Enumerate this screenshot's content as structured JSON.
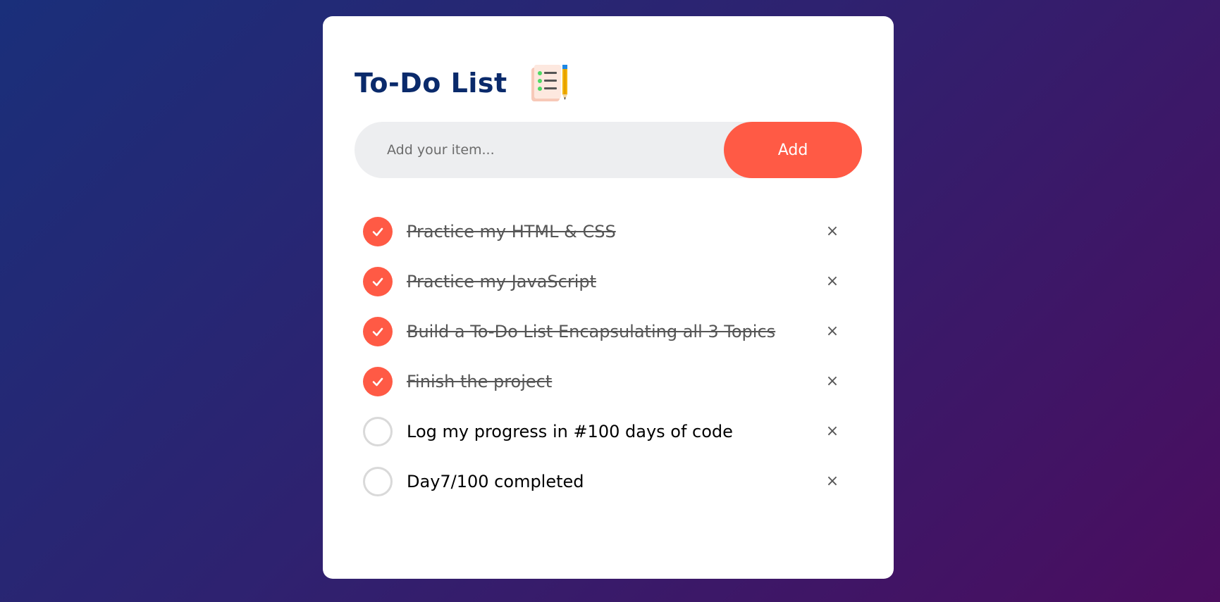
{
  "header": {
    "title": "To-Do List",
    "icon": "checklist-notepad-pencil-icon"
  },
  "input": {
    "placeholder": "Add your item...",
    "value": ""
  },
  "add_button": {
    "label": "Add"
  },
  "colors": {
    "accent": "#ff5a45",
    "title": "#0a2a6b",
    "input_bg": "#edeef0"
  },
  "items": [
    {
      "text": "Practice my HTML & CSS",
      "checked": true,
      "remove_label": "×"
    },
    {
      "text": "Practice my JavaScript",
      "checked": true,
      "remove_label": "×"
    },
    {
      "text": "Build a To-Do List Encapsulating all 3 Topics",
      "checked": true,
      "remove_label": "×"
    },
    {
      "text": "Finish the project",
      "checked": true,
      "remove_label": "×"
    },
    {
      "text": "Log my progress in #100 days of code",
      "checked": false,
      "remove_label": "×"
    },
    {
      "text": "Day7/100 completed",
      "checked": false,
      "remove_label": "×"
    }
  ]
}
